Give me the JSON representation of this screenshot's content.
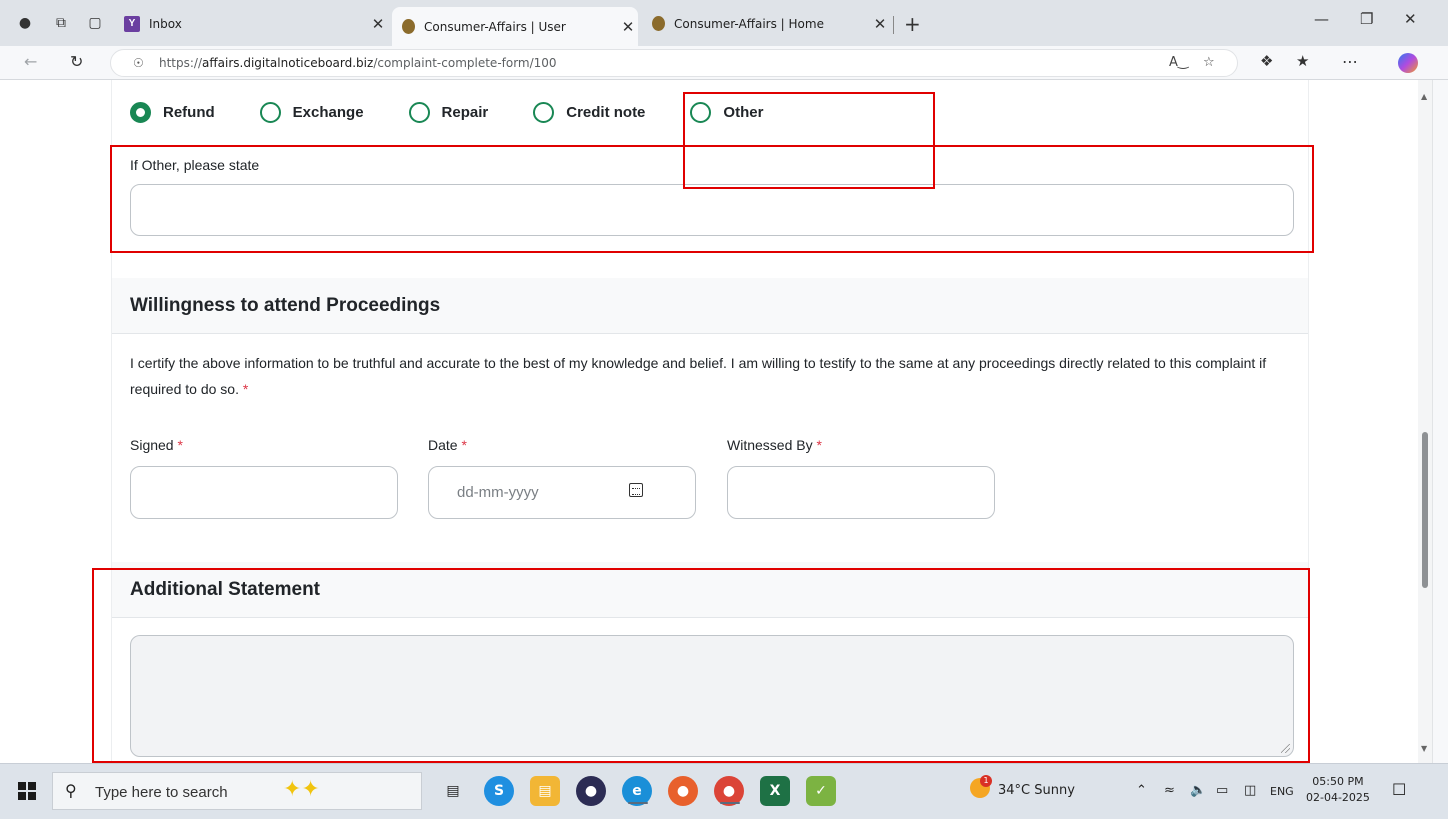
{
  "browser": {
    "tabs": [
      {
        "title": "Inbox",
        "favicon": "yahoo-mail-icon"
      },
      {
        "title": "Consumer-Affairs | User",
        "favicon": "consumer-affairs-icon"
      },
      {
        "title": "Consumer-Affairs | Home",
        "favicon": "consumer-affairs-icon"
      }
    ],
    "url_scheme": "https://",
    "url_host": "affairs.digitalnoticeboard.biz",
    "url_path": "/complaint-complete-form/100"
  },
  "form": {
    "remedy_options": [
      {
        "label": "Refund",
        "checked": true
      },
      {
        "label": "Exchange",
        "checked": false
      },
      {
        "label": "Repair",
        "checked": false
      },
      {
        "label": "Credit note",
        "checked": false
      },
      {
        "label": "Other",
        "checked": false
      }
    ],
    "other_label": "If Other, please state",
    "other_value": "",
    "willingness_heading": "Willingness to attend Proceedings",
    "certification_text": "I certify the above information to be truthful and accurate to the best of my knowledge and belief. I am willing to testify to the same at any proceedings directly related to this complaint if required to do so.",
    "required_mark": "*",
    "signed_label": "Signed",
    "date_label": "Date",
    "date_placeholder": "dd-mm-yyyy",
    "witnessed_label": "Witnessed By",
    "additional_heading": "Additional Statement"
  },
  "taskbar": {
    "search_placeholder": "Type here to search",
    "weather": "34°C  Sunny",
    "language": "ENG",
    "time": "05:50 PM",
    "date": "02-04-2025",
    "weather_badge": "1"
  },
  "colors": {
    "accent_green": "#198754",
    "required_red": "#dc3545",
    "annotation_red": "#e00000"
  }
}
